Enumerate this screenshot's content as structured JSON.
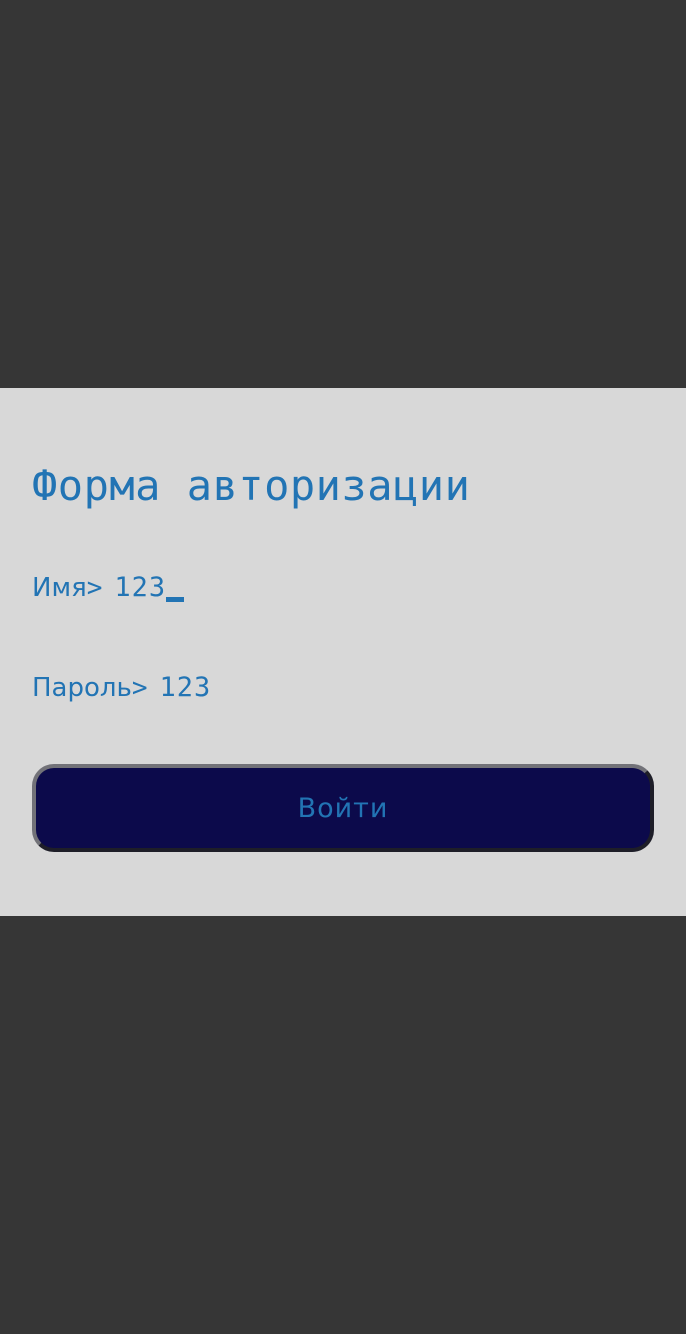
{
  "form": {
    "title": "Форма авторизации",
    "fields": {
      "name": {
        "label": "Имя",
        "prompt": ">",
        "value": "123"
      },
      "password": {
        "label": "Пароль",
        "prompt": ">",
        "value": "123"
      }
    },
    "submit_label": "Войти"
  },
  "colors": {
    "background": "#363636",
    "panel": "#d8d8d8",
    "accent_text": "#2274b4",
    "button_fill": "#0c0a4b"
  }
}
